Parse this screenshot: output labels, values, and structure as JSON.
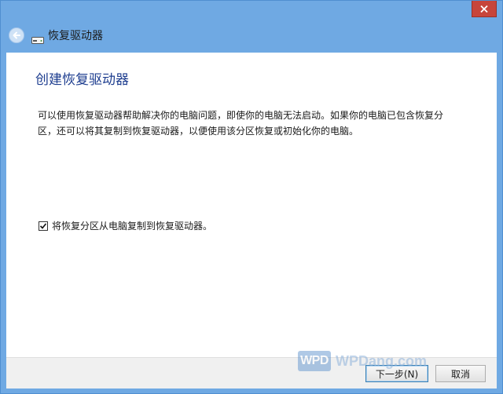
{
  "window": {
    "title": "恢复驱动器"
  },
  "content": {
    "heading": "创建恢复驱动器",
    "description": "可以使用恢复驱动器帮助解决你的电脑问题，即使你的电脑无法启动。如果你的电脑已包含恢复分区，还可以将其复制到恢复驱动器，以便使用该分区恢复或初始化你的电脑。",
    "checkbox": {
      "label": "将恢复分区从电脑复制到恢复驱动器。",
      "checked": true
    }
  },
  "footer": {
    "next_label": "下一步(N)",
    "cancel_label": "取消"
  },
  "watermark": {
    "logo_text": "WPD",
    "site_text": "WPDang.com"
  },
  "icons": {
    "back": "back-arrow-icon",
    "drive": "drive-icon",
    "close": "close-icon",
    "check": "checkmark-icon"
  },
  "colors": {
    "frame": "#6fa9e3",
    "heading": "#1d3d8f",
    "close_button": "#c7453b"
  }
}
